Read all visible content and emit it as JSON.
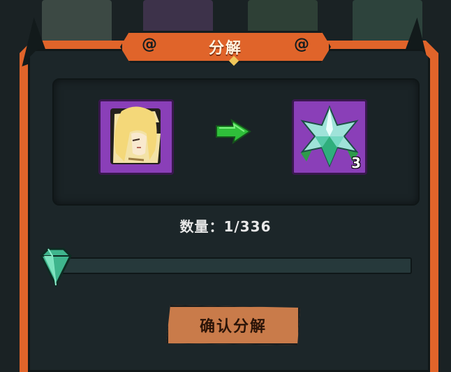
{
  "dialog": {
    "title": "分解",
    "confirm_label": "确认分解"
  },
  "source_item": {
    "name_icon": "blonde-character-fragment-icon",
    "rarity_color": "#8a3fb8"
  },
  "result_item": {
    "name_icon": "green-crystal-icon",
    "quantity": "3",
    "rarity_color": "#8a3fb8"
  },
  "quantity_text": "数量：1/336",
  "slider": {
    "current": 1,
    "max": 336
  },
  "colors": {
    "frame": "#e0642a",
    "panel": "#1c2629",
    "arrow": "#2fbf3a",
    "button": "#c97b4a"
  }
}
